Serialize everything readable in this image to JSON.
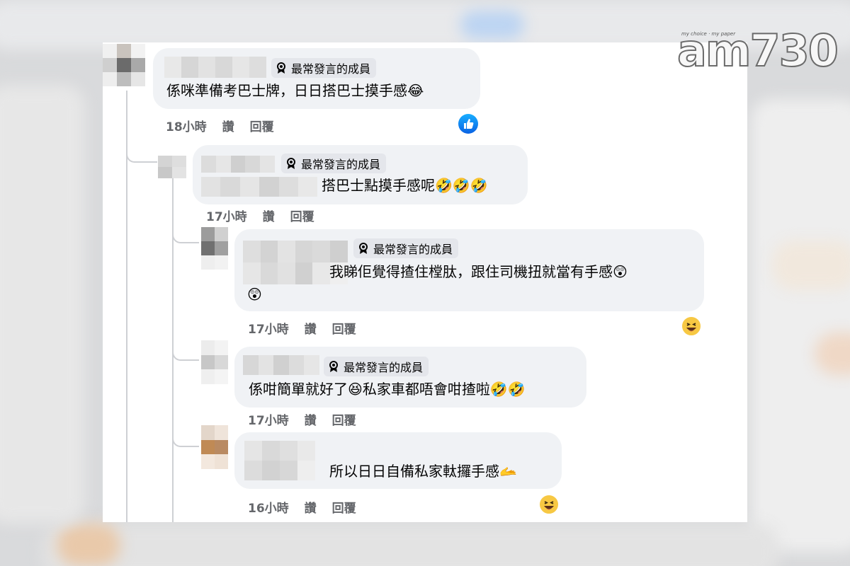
{
  "badge_label": "最常發言的成員",
  "logo": {
    "tagline": "my choice · my paper",
    "text": "am730"
  },
  "comments": [
    {
      "text": "係咪準備考巴士牌，日日搭巴士摸手感",
      "emoji": "😂",
      "time": "18小時",
      "like": "讚",
      "reply": "回覆",
      "reaction": "like-icon"
    },
    {
      "text": "搭巴士點摸手感呢",
      "emoji": "🤣🤣🤣",
      "time": "17小時",
      "like": "讚",
      "reply": "回覆"
    },
    {
      "text": "我睇佢覺得揸住樘肽，跟住司機扭就當有手感",
      "emoji": "😲",
      "emoji2": "😲",
      "time": "17小時",
      "like": "讚",
      "reply": "回覆",
      "reaction": "haha-icon"
    },
    {
      "text": "係咁簡單就好了",
      "emoji": "😆",
      "text2": "私家車都唔會咁揸啦",
      "emoji2": "🤣🤣",
      "time": "17小時",
      "like": "讚",
      "reply": "回覆"
    },
    {
      "text": "所以日日自備私家軚攞手感",
      "emoji": "🫴",
      "time": "16小時",
      "like": "讚",
      "reply": "回覆",
      "reaction": "haha-icon"
    }
  ],
  "colors": {
    "bubble": "#f0f2f5",
    "meta": "#65676b",
    "like_blue": "#1877f2"
  }
}
